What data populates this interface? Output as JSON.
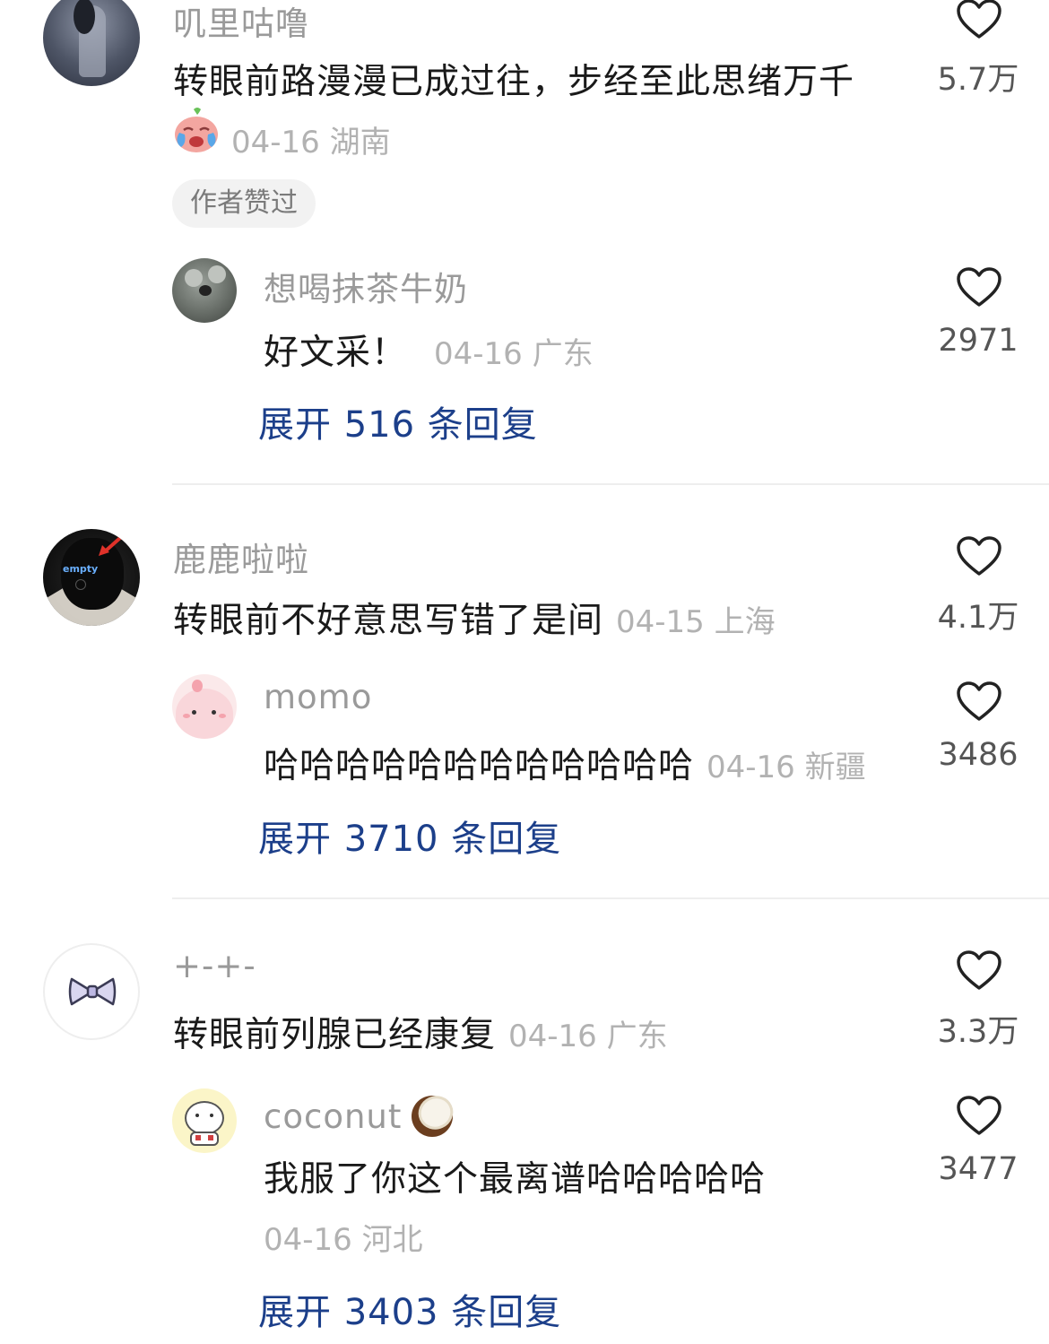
{
  "comments": [
    {
      "user": "叽里咕噜",
      "text": "转眼前路漫漫已成过往，步经至此思绪万千",
      "meta": "04-16 湖南",
      "likes": "5.7万",
      "badge": "作者赞过",
      "reply": {
        "user": "想喝抹茶牛奶",
        "text": "好文采！",
        "meta": "04-16 广东",
        "likes": "2971"
      },
      "expand": "展开 516 条回复"
    },
    {
      "user": "鹿鹿啦啦",
      "text": "转眼前不好意思写错了是间",
      "meta": "04-15 上海",
      "likes": "4.1万",
      "avatar_label": "empty",
      "reply": {
        "user": "momo",
        "text": "哈哈哈哈哈哈哈哈哈哈哈哈",
        "meta": "04-16 新疆",
        "likes": "3486"
      },
      "expand": "展开 3710 条回复"
    },
    {
      "user": "+-+-",
      "text": "转眼前列腺已经康复",
      "meta": "04-16 广东",
      "likes": "3.3万",
      "reply": {
        "user": "coconut",
        "text": "我服了你这个最离谱哈哈哈哈哈",
        "meta": "04-16 河北",
        "likes": "3477"
      },
      "expand": "展开 3403 条回复"
    }
  ],
  "colors": {
    "link": "#1c3f8a",
    "meta": "#b2b2b2",
    "name": "#9a9a9a"
  },
  "icons": [
    "heart-outline-icon",
    "crying-emoji-icon",
    "coconut-emoji-icon"
  ]
}
